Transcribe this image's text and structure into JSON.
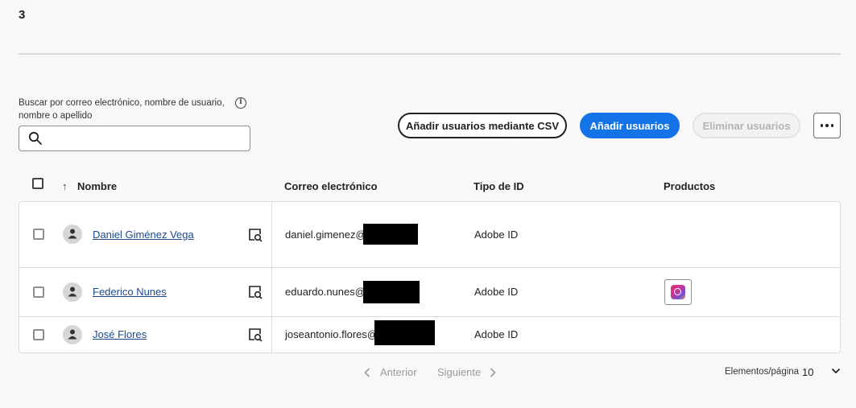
{
  "header": {
    "count": "3"
  },
  "search": {
    "label": "Buscar por correo electrónico, nombre de usuario, nombre o apellido",
    "value": "",
    "placeholder": ""
  },
  "toolbar": {
    "csv_label": "Añadir usuarios mediante CSV",
    "add_label": "Añadir usuarios",
    "delete_label": "Eliminar usuarios"
  },
  "table": {
    "columns": {
      "name": "Nombre",
      "email": "Correo electrónico",
      "idtype": "Tipo de ID",
      "products": "Productos"
    },
    "rows": [
      {
        "name": "Daniel Giménez Vega",
        "email": "daniel.gimenez@",
        "idtype": "Adobe ID",
        "products": []
      },
      {
        "name": "Federico Nunes",
        "email": "eduardo.nunes@",
        "idtype": "Adobe ID",
        "products": [
          "creative-cloud-icon"
        ]
      },
      {
        "name": "José Flores",
        "email": "joseantonio.flores@",
        "idtype": "Adobe ID",
        "products": []
      }
    ]
  },
  "pagination": {
    "prev_label": "Anterior",
    "next_label": "Siguiente",
    "per_page_label": "Elementos/página",
    "per_page_value": "10"
  },
  "colors": {
    "primary": "#1473e6",
    "link": "#1b4a8e",
    "disabled_text": "#b3b3b3"
  }
}
